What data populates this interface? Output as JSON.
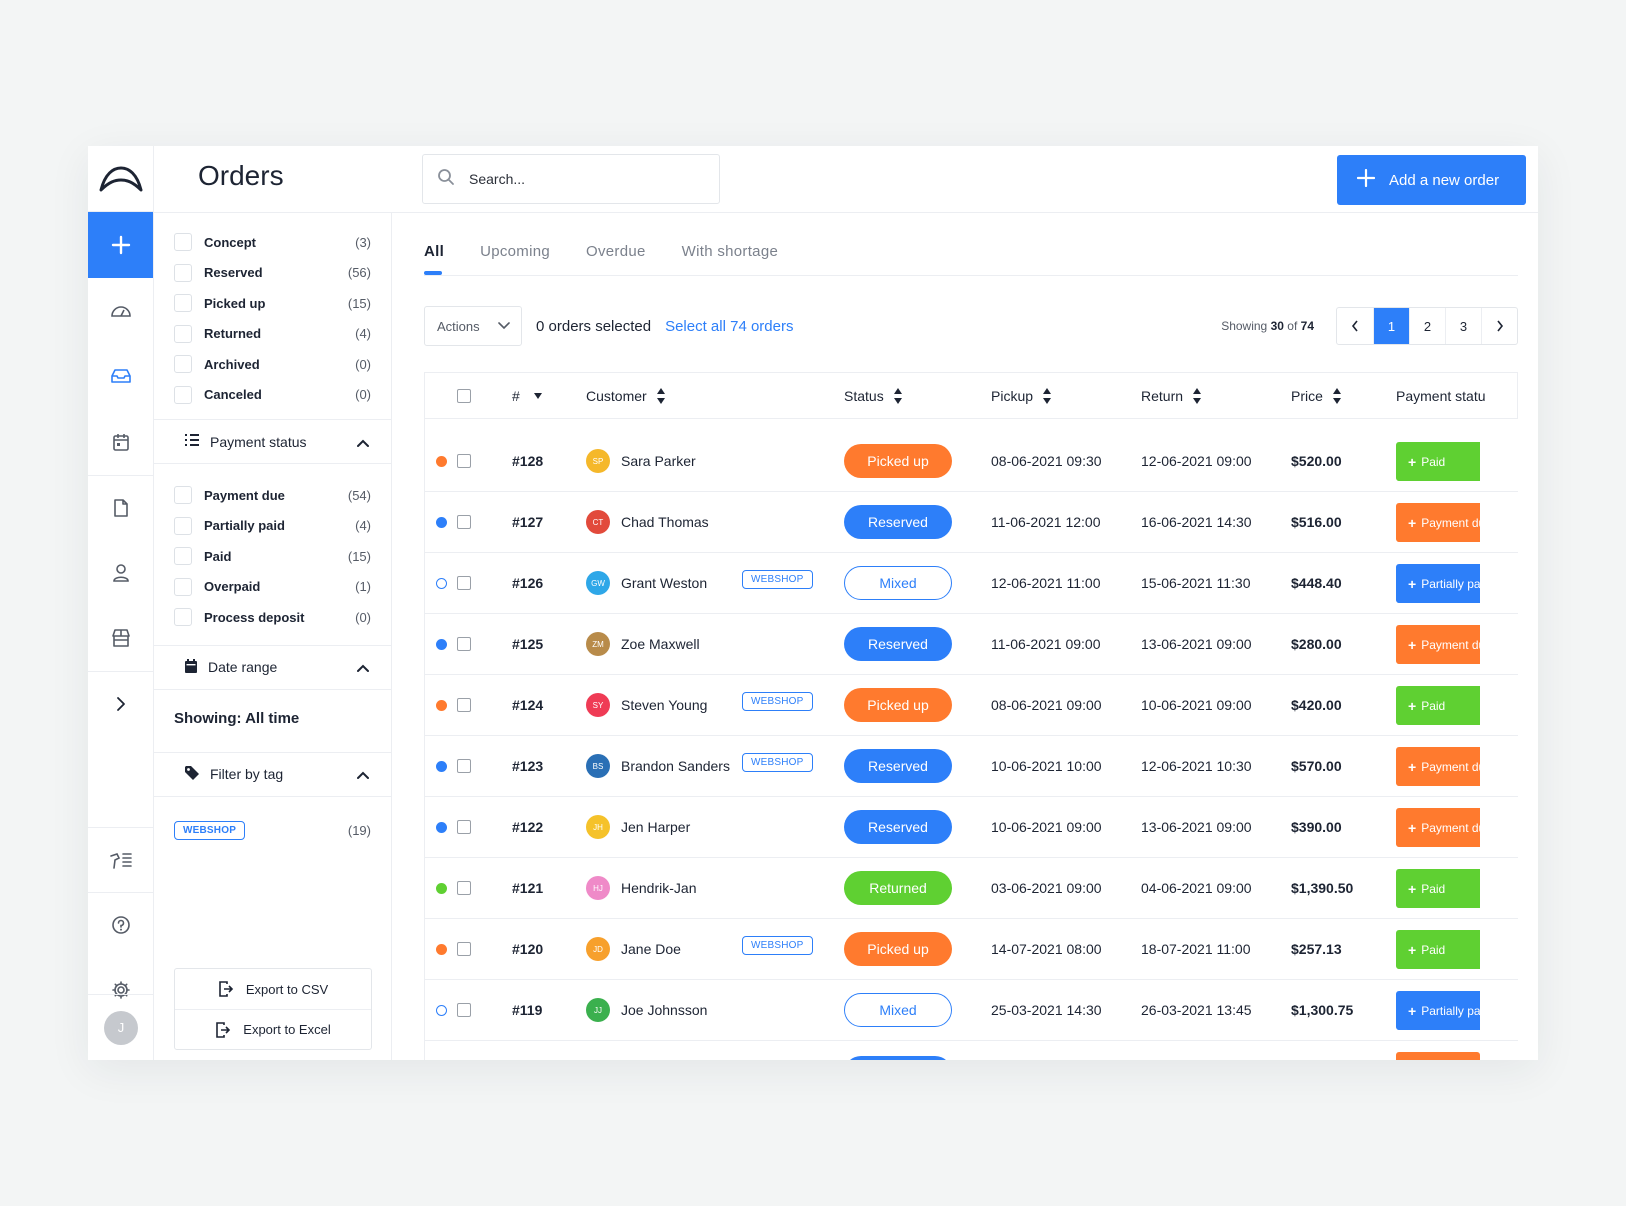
{
  "header": {
    "title": "Orders",
    "search_placeholder": "Search...",
    "add_button": "Add a new order"
  },
  "rail": {
    "avatar_initial": "J"
  },
  "filters": {
    "order_status": [
      {
        "label": "Concept",
        "count": "(3)"
      },
      {
        "label": "Reserved",
        "count": "(56)"
      },
      {
        "label": "Picked up",
        "count": "(15)"
      },
      {
        "label": "Returned",
        "count": "(4)"
      },
      {
        "label": "Archived",
        "count": "(0)"
      },
      {
        "label": "Canceled",
        "count": "(0)"
      }
    ],
    "payment_section": "Payment status",
    "payment_status": [
      {
        "label": "Payment due",
        "count": "(54)"
      },
      {
        "label": "Partially paid",
        "count": "(4)"
      },
      {
        "label": "Paid",
        "count": "(15)"
      },
      {
        "label": "Overpaid",
        "count": "(1)"
      },
      {
        "label": "Process deposit",
        "count": "(0)"
      }
    ],
    "date_section": "Date range",
    "date_showing": "Showing: All time",
    "tag_section": "Filter by tag",
    "tag": {
      "label": "WEBSHOP",
      "count": "(19)"
    },
    "export_csv": "Export to CSV",
    "export_excel": "Export to Excel"
  },
  "tabs": [
    "All",
    "Upcoming",
    "Overdue",
    "With shortage"
  ],
  "toolbar": {
    "actions": "Actions",
    "selected": "0 orders selected",
    "select_all": "Select all 74 orders",
    "showing_prefix": "Showing",
    "showing_count": "30",
    "showing_of": "of",
    "showing_total": "74",
    "pages": [
      "1",
      "2",
      "3"
    ],
    "active_page": "1"
  },
  "columns": {
    "num": "#",
    "customer": "Customer",
    "status": "Status",
    "pickup": "Pickup",
    "return": "Return",
    "price": "Price",
    "payment": "Payment statu"
  },
  "colors": {
    "accent": "#2d7ff9",
    "orange": "#ff7a2e",
    "green": "#5fd032",
    "blue": "#2d7ff9"
  },
  "orders": [
    {
      "dot": "orange",
      "id": "#128",
      "initials": "SP",
      "avatar": "#f5b82a",
      "customer": "Sara Parker",
      "tag": "",
      "status": "Picked up",
      "status_color": "orange",
      "pickup": "08-06-2021 09:30",
      "return": "12-06-2021 09:00",
      "price": "$520.00",
      "payment": "Paid",
      "payment_color": "green"
    },
    {
      "dot": "blue",
      "id": "#127",
      "initials": "CT",
      "avatar": "#e24a3b",
      "customer": "Chad Thomas",
      "tag": "",
      "status": "Reserved",
      "status_color": "blue",
      "pickup": "11-06-2021 12:00",
      "return": "16-06-2021 14:30",
      "price": "$516.00",
      "payment": "Payment due",
      "payment_color": "orange"
    },
    {
      "dot": "hollow",
      "id": "#126",
      "initials": "GW",
      "avatar": "#2ea7e8",
      "customer": "Grant Weston",
      "tag": "WEBSHOP",
      "status": "Mixed",
      "status_color": "hollow",
      "pickup": "12-06-2021 11:00",
      "return": "15-06-2021 11:30",
      "price": "$448.40",
      "payment": "Partially paid",
      "payment_color": "blue"
    },
    {
      "dot": "blue",
      "id": "#125",
      "initials": "ZM",
      "avatar": "#b88b4a",
      "customer": "Zoe Maxwell",
      "tag": "",
      "status": "Reserved",
      "status_color": "blue",
      "pickup": "11-06-2021 09:00",
      "return": "13-06-2021 09:00",
      "price": "$280.00",
      "payment": "Payment due",
      "payment_color": "orange"
    },
    {
      "dot": "orange",
      "id": "#124",
      "initials": "SY",
      "avatar": "#ef3b55",
      "customer": "Steven Young",
      "tag": "WEBSHOP",
      "status": "Picked up",
      "status_color": "orange",
      "pickup": "08-06-2021 09:00",
      "return": "10-06-2021 09:00",
      "price": "$420.00",
      "payment": "Paid",
      "payment_color": "green"
    },
    {
      "dot": "blue",
      "id": "#123",
      "initials": "BS",
      "avatar": "#2a6fb5",
      "customer": "Brandon Sanders",
      "tag": "WEBSHOP",
      "status": "Reserved",
      "status_color": "blue",
      "pickup": "10-06-2021 10:00",
      "return": "12-06-2021 10:30",
      "price": "$570.00",
      "payment": "Payment due",
      "payment_color": "orange"
    },
    {
      "dot": "blue",
      "id": "#122",
      "initials": "JH",
      "avatar": "#f5c22a",
      "customer": "Jen Harper",
      "tag": "",
      "status": "Reserved",
      "status_color": "blue",
      "pickup": "10-06-2021 09:00",
      "return": "13-06-2021 09:00",
      "price": "$390.00",
      "payment": "Payment due",
      "payment_color": "orange"
    },
    {
      "dot": "green",
      "id": "#121",
      "initials": "HJ",
      "avatar": "#ef8ac8",
      "customer": "Hendrik-Jan",
      "tag": "",
      "status": "Returned",
      "status_color": "green",
      "pickup": "03-06-2021 09:00",
      "return": "04-06-2021 09:00",
      "price": "$1,390.50",
      "payment": "Paid",
      "payment_color": "green"
    },
    {
      "dot": "orange",
      "id": "#120",
      "initials": "JD",
      "avatar": "#f7a02c",
      "customer": "Jane Doe",
      "tag": "WEBSHOP",
      "status": "Picked up",
      "status_color": "orange",
      "pickup": "14-07-2021 08:00",
      "return": "18-07-2021 11:00",
      "price": "$257.13",
      "payment": "Paid",
      "payment_color": "green"
    },
    {
      "dot": "hollow",
      "id": "#119",
      "initials": "JJ",
      "avatar": "#3bb04e",
      "customer": "Joe Johnsson",
      "tag": "",
      "status": "Mixed",
      "status_color": "hollow",
      "pickup": "25-03-2021 14:30",
      "return": "26-03-2021 13:45",
      "price": "$1,300.75",
      "payment": "Partially paid",
      "payment_color": "blue"
    }
  ]
}
